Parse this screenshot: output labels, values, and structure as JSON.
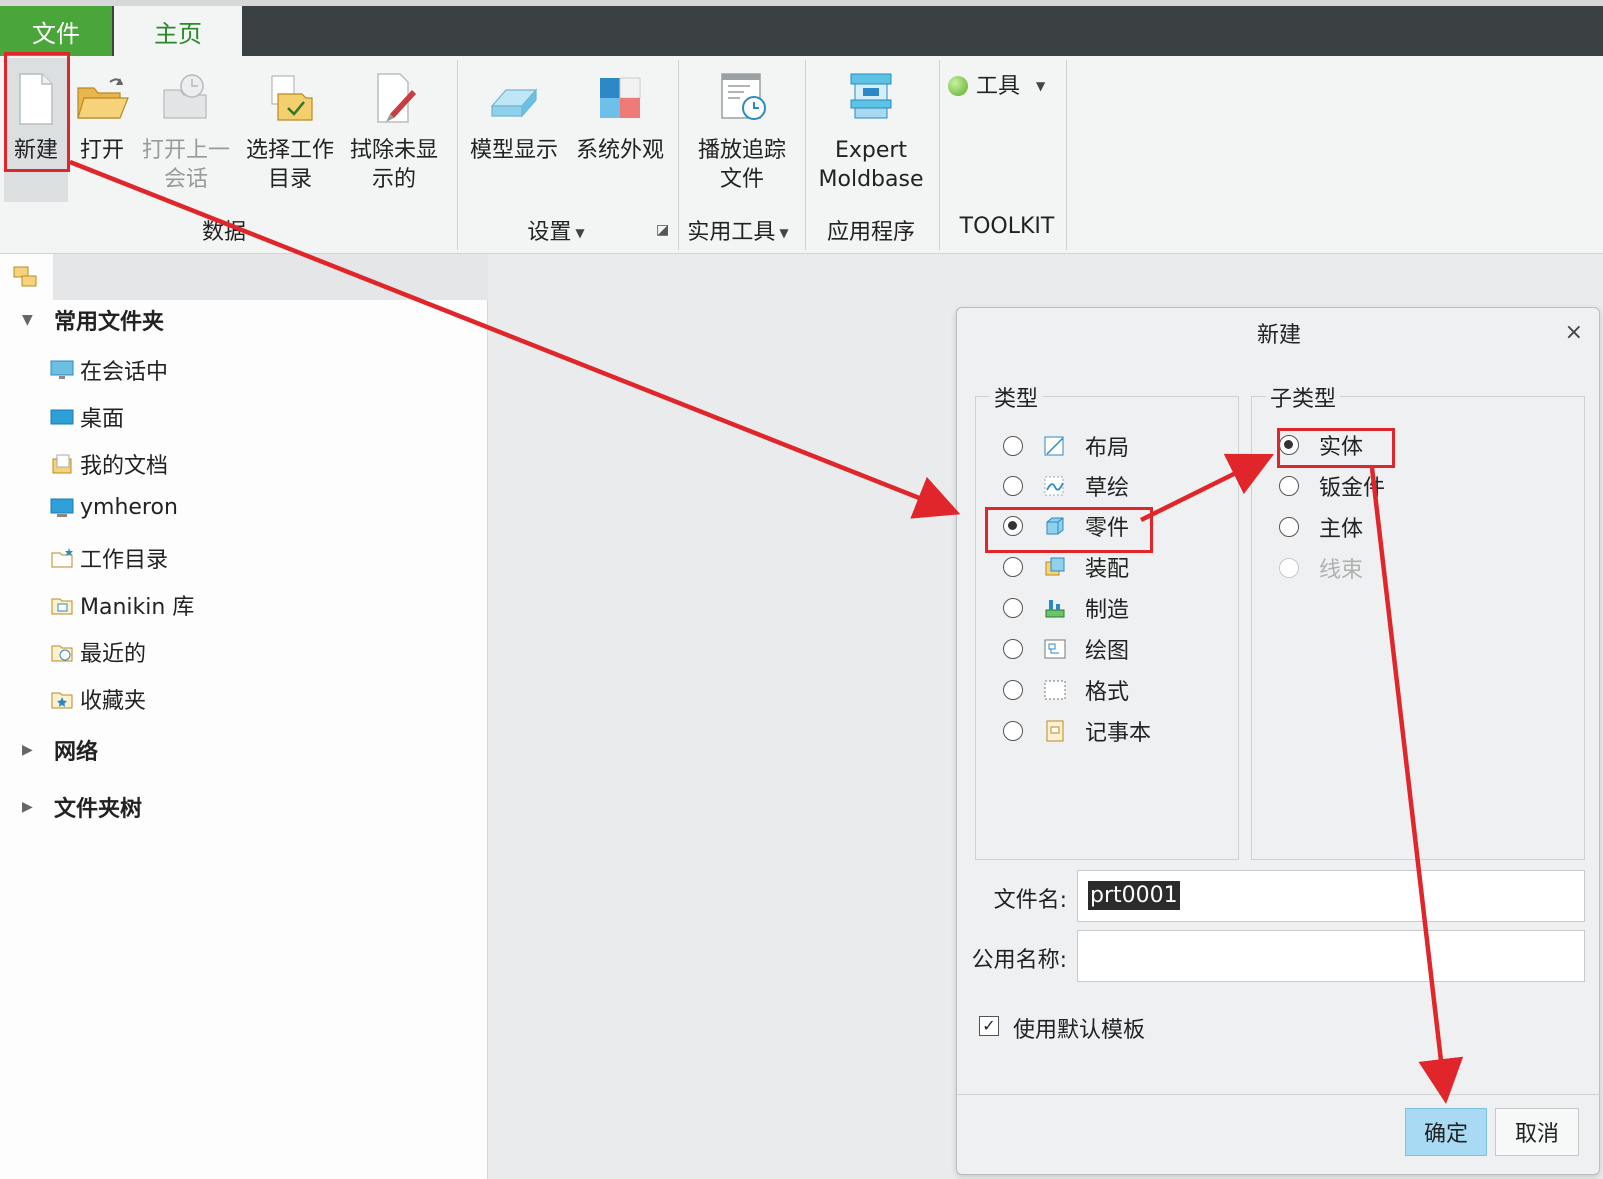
{
  "tabs": {
    "file": "文件",
    "home": "主页"
  },
  "ribbon": {
    "buttons": {
      "new": "新建",
      "open": "打开",
      "open_last": "打开上一\n会话",
      "select_dir": "选择工作\n目录",
      "erase": "拭除未显\n示的",
      "model_display": "模型显示",
      "system_appearance": "系统外观",
      "play_trail": "播放追踪\n文件",
      "expert": "Expert\nMoldbase",
      "tools": "工具"
    },
    "groups": {
      "data": "数据",
      "settings": "设置",
      "utilities": "实用工具",
      "apps": "应用程序",
      "toolkit": "TOOLKIT"
    }
  },
  "navigator": {
    "sections": {
      "common": "常用文件夹",
      "network": "网络",
      "tree": "文件夹树"
    },
    "items": [
      "在会话中",
      "桌面",
      "我的文档",
      "ymheron",
      "工作目录",
      "Manikin 库",
      "最近的",
      "收藏夹"
    ]
  },
  "dialog": {
    "title": "新建",
    "close": "×",
    "type_legend": "类型",
    "subtype_legend": "子类型",
    "types": [
      "布局",
      "草绘",
      "零件",
      "装配",
      "制造",
      "绘图",
      "格式",
      "记事本"
    ],
    "selected_type": "零件",
    "subtypes": [
      "实体",
      "钣金件",
      "主体",
      "线束"
    ],
    "selected_subtype": "实体",
    "file_name_label": "文件名:",
    "file_name_value": "prt0001",
    "common_name_label": "公用名称:",
    "common_name_value": "",
    "use_template_label": "使用默认模板",
    "use_template_checked": true,
    "ok": "确定",
    "cancel": "取消"
  },
  "colors": {
    "annotation": "#e0262b",
    "primary_button": "#a8dbf3",
    "file_tab": "#4aa53b"
  }
}
